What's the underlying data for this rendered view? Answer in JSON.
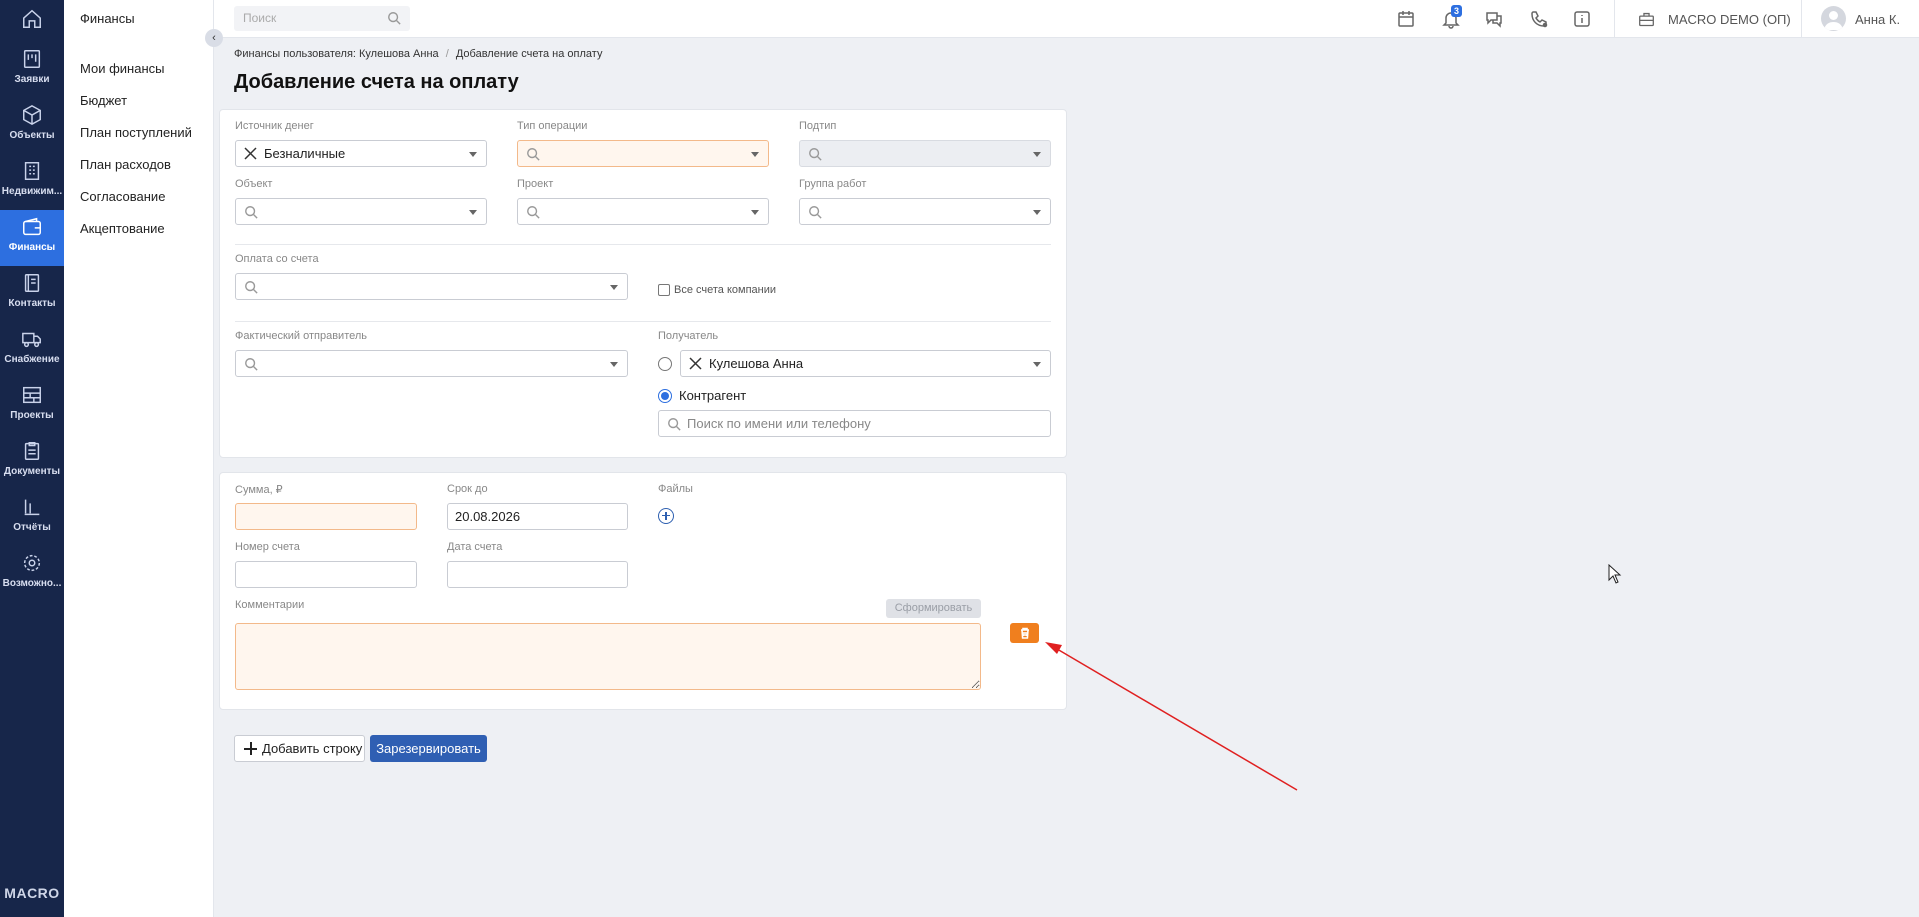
{
  "rail": {
    "items": [
      {
        "label": "Заявки",
        "icon": "clipboard-icon"
      },
      {
        "label": "Объекты",
        "icon": "cube-icon"
      },
      {
        "label": "Недвижим...",
        "icon": "building-icon"
      },
      {
        "label": "Финансы",
        "icon": "wallet-icon",
        "active": true
      },
      {
        "label": "Контакты",
        "icon": "contacts-icon"
      },
      {
        "label": "Снабжение",
        "icon": "truck-icon"
      },
      {
        "label": "Проекты",
        "icon": "projects-icon"
      },
      {
        "label": "Документы",
        "icon": "document-icon"
      },
      {
        "label": "Отчёты",
        "icon": "reports-icon"
      },
      {
        "label": "Возможно...",
        "icon": "settings-icon"
      }
    ],
    "logo": "MACRO"
  },
  "subnav": {
    "title": "Финансы",
    "items": [
      "Мои финансы",
      "Бюджет",
      "План поступлений",
      "План расходов",
      "Согласование",
      "Акцептование"
    ]
  },
  "topbar": {
    "search_placeholder": "Поиск",
    "notif_count": "3",
    "company": "MACRO DEMO (ОП)",
    "user": "Анна К."
  },
  "breadcrumb": {
    "parent": "Финансы пользователя: Кулешова Анна",
    "separator": "/",
    "current": "Добавление счета на оплату"
  },
  "page_title": "Добавление счета на оплату",
  "form": {
    "source_label": "Источник денег",
    "source_value": "Безналичные",
    "op_type_label": "Тип операции",
    "subtype_label": "Подтип",
    "object_label": "Объект",
    "project_label": "Проект",
    "workgroup_label": "Группа работ",
    "pay_from_label": "Оплата со счета",
    "all_accounts_label": "Все счета компании",
    "sender_label": "Фактический отправитель",
    "recipient_label": "Получатель",
    "recipient_value": "Кулешова Анна",
    "counterparty_label": "Контрагент",
    "counterparty_placeholder": "Поиск по имени или телефону",
    "sum_label": "Сумма, ₽",
    "due_label": "Срок до",
    "due_value": "20.08.2026",
    "files_label": "Файлы",
    "invoice_no_label": "Номер счета",
    "invoice_date_label": "Дата счета",
    "comment_label": "Комментарии",
    "generate_label": "Сформировать"
  },
  "actions": {
    "add_row": "Добавить строку",
    "reserve": "Зарезервировать"
  },
  "colors": {
    "rail_bg": "#17264a",
    "accent": "#2d6fe0",
    "primary_button": "#2f5fb3",
    "delete_button": "#f07f1e",
    "annotation_arrow": "#e02020"
  }
}
